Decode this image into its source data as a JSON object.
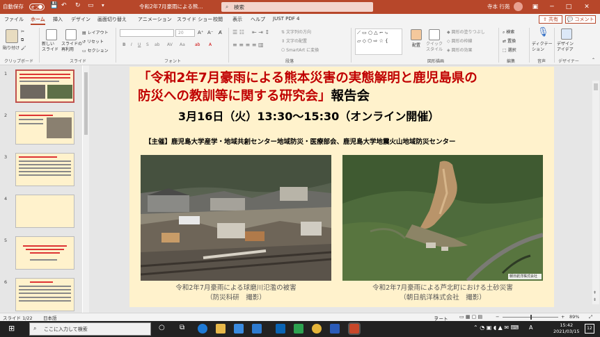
{
  "titlebar": {
    "autosave": "自動保存",
    "toggle": "オフ",
    "doc_title": "令和2年7月豪雨による熊...",
    "search": "検索",
    "user": "寺本 行苑"
  },
  "tabs": [
    "ファイル",
    "ホーム",
    "挿入",
    "デザイン",
    "画面切り替え",
    "アニメーション",
    "スライド ショー",
    "校閲",
    "表示",
    "ヘルプ",
    "JUST PDF 4"
  ],
  "share": "共有",
  "comment": "コメント",
  "ribbon": {
    "paste": "貼り付け",
    "clipboard": "クリップボード",
    "new_slide": "新しい\nスライド",
    "reuse": "スライドの\n再利用",
    "layout": "レイアウト",
    "reset": "リセット",
    "section": "セクション",
    "slides": "スライド",
    "font_size": "20",
    "font": "フォント",
    "text_direction": "文字列の方向",
    "align_text": "文字の配置",
    "smartart": "SmartArt に変換",
    "paragraph": "段落",
    "arrange": "配置",
    "quick_styles": "クイック\nスタイル",
    "drawing": "図形描画",
    "shape_fill": "図形の塗りつぶし",
    "shape_outline": "図形の枠線",
    "shape_effects": "図形の効果",
    "find": "検索",
    "replace": "置換",
    "select": "選択",
    "editing": "編集",
    "dictate": "ディクテー\nション",
    "voice": "音声",
    "designer": "デザイン\nアイデア",
    "designer_group": "デザイナー"
  },
  "thumbs": [
    "1",
    "2",
    "3",
    "4",
    "5",
    "6"
  ],
  "slide": {
    "title_line1": "「令和2年7月豪雨による熊本災害の実態解明と鹿児島県の",
    "title_line2a": "防災への教訓等に関する研究会」",
    "title_line2b": "報告会",
    "date": "3月16日（火）13:30〜15:30（オンライン開催）",
    "organizers": "【主催】鹿児島大学産学・地域共創センター地域防災・医療部会、鹿児島大学地震火山地域防災センター",
    "caption_left_1": "令和2年7月豪雨による球磨川氾濫の被害",
    "caption_left_2": "（防災科研　撮影）",
    "caption_right_1": "令和2年7月豪雨による芦北町における土砂災害",
    "caption_right_2": "（朝日航洋株式会社　撮影）",
    "watermark": "朝日航洋株式会社"
  },
  "status": {
    "slide": "スライド 1/22",
    "lang": "日本語",
    "notes": "ノート",
    "zoom": "89%"
  },
  "taskbar": {
    "search": "ここに入力して検索",
    "time": "15:42",
    "date": "2021/03/15",
    "lang": "A",
    "badge": "12"
  },
  "colors": {
    "accent": "#b7472a",
    "title_red": "#c00000",
    "slide_bg": "#fff2cc"
  }
}
